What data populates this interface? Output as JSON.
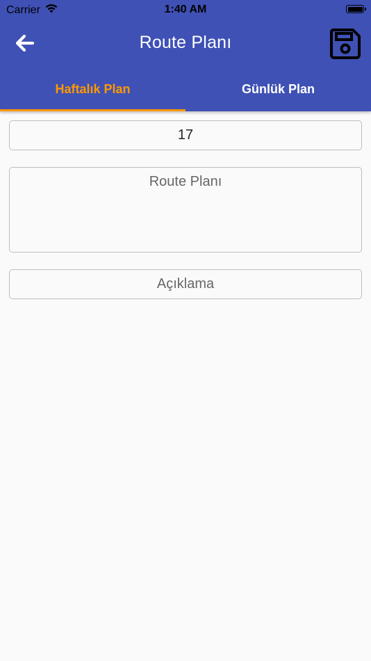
{
  "status_bar": {
    "carrier": "Carrier",
    "time": "1:40 AM"
  },
  "app_bar": {
    "title": "Route Planı",
    "color": "#3f51b5"
  },
  "tabs": [
    {
      "label": "Haftalık Plan",
      "active": true
    },
    {
      "label": "Günlük Plan",
      "active": false
    }
  ],
  "colors": {
    "accent": "#ff9800",
    "background": "#fafafa"
  },
  "form": {
    "week_value": "17",
    "route_plan_placeholder": "Route Planı",
    "description_placeholder": "Açıklama"
  },
  "icons": {
    "back": "arrow-left-icon",
    "save": "floppy-disk-icon",
    "wifi": "wifi-icon",
    "battery": "battery-icon"
  }
}
